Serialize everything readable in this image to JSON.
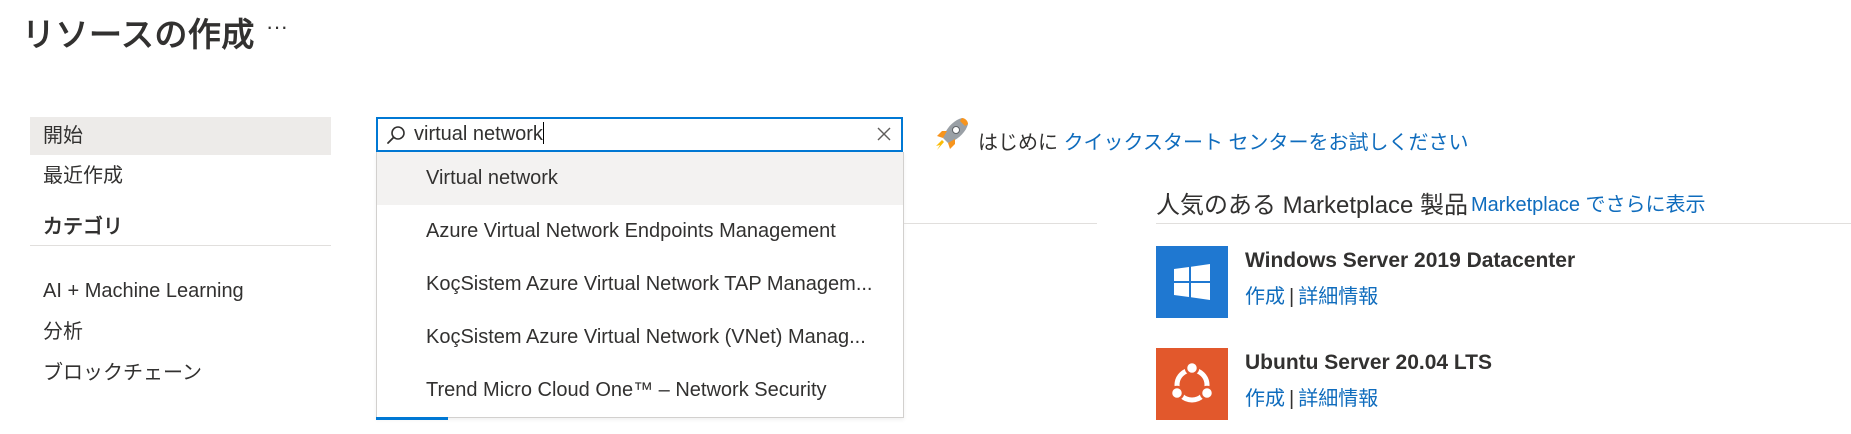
{
  "header": {
    "title": "リソースの作成",
    "more_label": "···"
  },
  "sidebar": {
    "items_top": [
      {
        "label": "開始",
        "selected": true
      },
      {
        "label": "最近作成",
        "selected": false
      }
    ],
    "categories_heading": "カテゴリ",
    "categories": [
      {
        "label": "AI + Machine Learning"
      },
      {
        "label": "分析"
      },
      {
        "label": "ブロックチェーン"
      }
    ]
  },
  "search": {
    "value": "virtual network",
    "icon": "search-icon",
    "clear_icon": "close-icon",
    "suggestions": [
      {
        "label": "Virtual network"
      },
      {
        "label": "Azure Virtual Network Endpoints Management"
      },
      {
        "label": "KoçSistem Azure Virtual Network TAP Managem..."
      },
      {
        "label": "KoçSistem Azure Virtual Network (VNet) Manag..."
      },
      {
        "label": "Trend Micro Cloud One™ – Network Security"
      }
    ]
  },
  "quickstart": {
    "icon": "rocket-icon",
    "prefix": "はじめに ",
    "link": "クイックスタート センターをお試しください"
  },
  "marketplace": {
    "title": "人気のある Marketplace 製品",
    "more_link": "Marketplace でさらに表示",
    "products": [
      {
        "name": "Windows Server 2019 Datacenter",
        "create": "作成",
        "separator": "|",
        "details": "詳細情報",
        "logo": "windows-logo-icon",
        "logo_color": "#1f78d1"
      },
      {
        "name": "Ubuntu Server 20.04 LTS",
        "create": "作成",
        "separator": "|",
        "details": "詳細情報",
        "logo": "ubuntu-logo-icon",
        "logo_color": "#e2582c"
      }
    ]
  },
  "colors": {
    "accent": "#0078d4",
    "link": "#0f6cbd",
    "selected_bg": "#edebe9"
  }
}
